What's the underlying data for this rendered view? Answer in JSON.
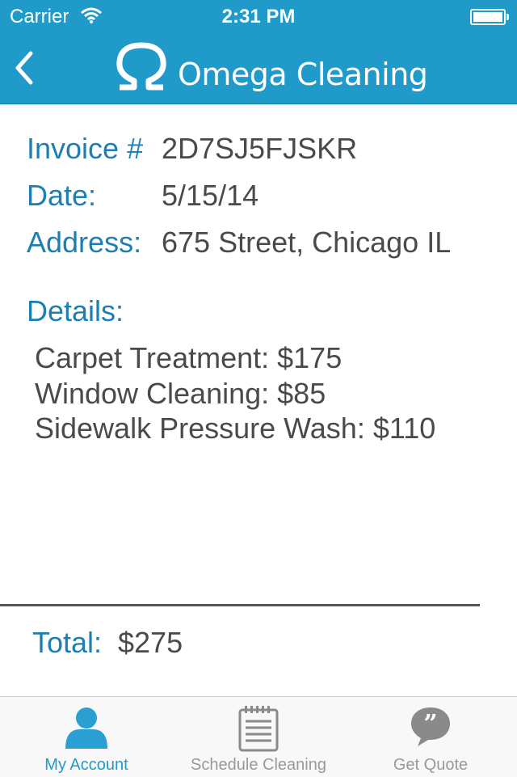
{
  "status_bar": {
    "carrier": "Carrier",
    "time": "2:31 PM"
  },
  "header": {
    "title": "Omega Cleaning",
    "logo_symbol": "Ω",
    "back_icon": "chevron-left-icon"
  },
  "invoice": {
    "invoice_label": "Invoice #",
    "invoice_number": "2D7SJ5FJSKR",
    "date_label": "Date:",
    "date": "5/15/14",
    "address_label": "Address:",
    "address": "675 Street, Chicago IL",
    "details_label": "Details:",
    "details": [
      "Carpet Treatment: $175",
      "Window Cleaning: $85",
      "Sidewalk Pressure Wash: $110"
    ],
    "total_label": "Total:",
    "total": "$275"
  },
  "tab_bar": {
    "tabs": [
      {
        "label": "My Account",
        "icon": "person-icon",
        "active": true
      },
      {
        "label": "Schedule Cleaning",
        "icon": "clipboard-icon",
        "active": false
      },
      {
        "label": "Get Quote",
        "icon": "quote-bubble-icon",
        "active": false
      }
    ]
  },
  "colors": {
    "header_bg": "#1f9ac9",
    "label_blue": "#1d7fb1",
    "text_gray": "#4a4a4a",
    "tab_inactive": "#999999"
  }
}
